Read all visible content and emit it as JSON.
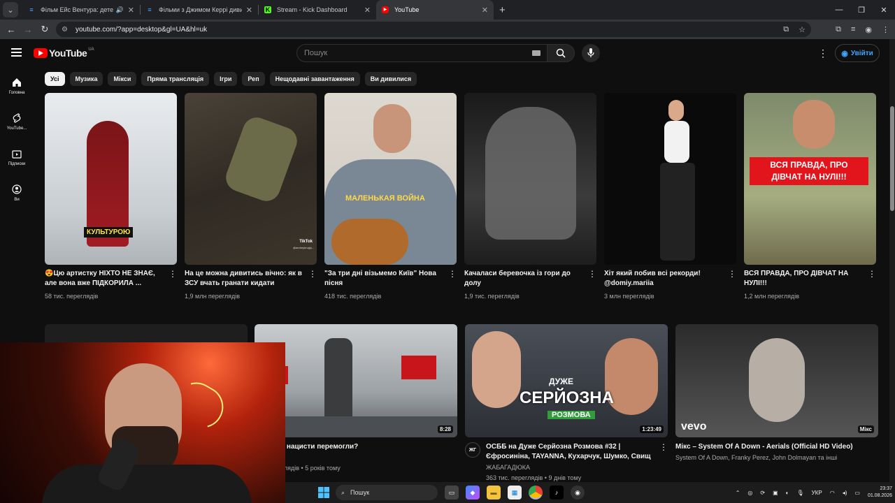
{
  "browser": {
    "tabs": [
      {
        "title": "Фільм Ейс Вентура: детект",
        "icon": "film-site-icon",
        "active": false,
        "audio": true
      },
      {
        "title": "Фільми з Джимом Керрі диви",
        "icon": "film-site-icon",
        "active": false,
        "audio": false
      },
      {
        "title": "Stream - Kick Dashboard",
        "icon": "kick-icon",
        "active": false,
        "audio": false
      },
      {
        "title": "YouTube",
        "icon": "youtube-icon",
        "active": true,
        "audio": false
      }
    ],
    "url": "youtube.com/?app=desktop&gl=UA&hl=uk"
  },
  "youtube": {
    "logo_text": "YouTube",
    "region": "UA",
    "search_placeholder": "Пошук",
    "signin_label": "Увійти",
    "guide": [
      {
        "label": "Головна",
        "icon": "home-icon"
      },
      {
        "label": "YouTube...",
        "icon": "shorts-icon"
      },
      {
        "label": "Підписки",
        "icon": "subscriptions-icon"
      },
      {
        "label": "Ви",
        "icon": "you-icon"
      }
    ],
    "chips": [
      "Усі",
      "Музика",
      "Мікси",
      "Пряма трансляція",
      "Ігри",
      "Реп",
      "Нещодавні завантаження",
      "Ви дивилися"
    ],
    "shorts": [
      {
        "title": "😍Цю артистку НІХТО НЕ ЗНАЄ, але вона вже ПІДКОРИЛА ...",
        "views": "58 тис. переглядів",
        "overlay": "КУЛЬТУРОЮ"
      },
      {
        "title": "На це можна дивитись вічно: як в ЗСУ вчать гранати кидати",
        "views": "1,9 млн переглядів",
        "overlay": "TikTok",
        "overlay2": "@andreykrugly..."
      },
      {
        "title": "\"За три дні візьмемо Київ\" Нова пісня",
        "views": "418 тис. переглядів",
        "overlay": "МАЛЕНЬКАЯ ВОЙНА"
      },
      {
        "title": "Качалаcи беревочка із гори до долу",
        "views": "1,9 тис. переглядів",
        "overlay": ""
      },
      {
        "title": "Хіт який побив всі рекорди! @domiy.mariia",
        "views": "3 млн переглядів",
        "overlay": ""
      },
      {
        "title": "ВСЯ ПРАВДА, ПРО ДІВЧАТ НА НУЛІ!!!",
        "views": "1,2 млн переглядів",
        "overlay": "ВСЯ ПРАВДА, ПРО ДІВЧАТ НА НУЛІ!!!"
      }
    ],
    "videos": [
      {
        "title": "що, якби нацисти перемогли?",
        "line1": "si?",
        "line2": "млн переглядів • 5 років тому",
        "duration": "8:28",
        "avatar": ""
      },
      {
        "title": "ОСББ на Дуже Серйозна Розмова #32 | Єфросиніна, TAYANNA, Кухарчук, Шумко, Свищ",
        "line1": "ЖАБАГАДЮКА",
        "line2": "363 тис. переглядів • 9 днів тому",
        "duration": "1:23:49",
        "avatar": "ЖГ",
        "overlay_big": "СЕРЙОЗНА",
        "overlay_top": "ДУЖЕ",
        "overlay_bot": "РОЗМОВА"
      },
      {
        "title": "Мікс – System Of A Down - Aerials (Official HD Video)",
        "line1": "System Of A Down, Franky Perez, John Dolmayan та інші",
        "line2": "",
        "duration": "Мікс",
        "avatar": "",
        "overlay": "vevo"
      }
    ]
  },
  "taskbar": {
    "search_label": "Пошук",
    "lang": "УКР",
    "time": "23:37",
    "date": "01.08.2026"
  }
}
